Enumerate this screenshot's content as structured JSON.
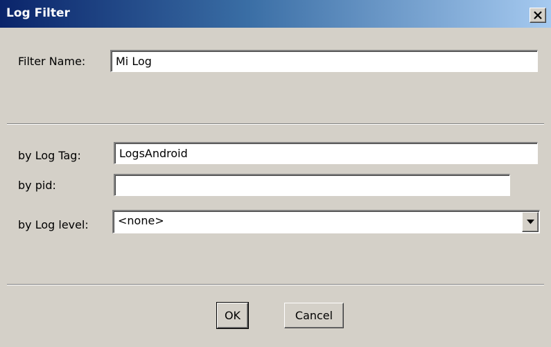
{
  "window": {
    "title": "Log Filter",
    "close_glyph": "X"
  },
  "filter_name": {
    "label": "Filter Name:",
    "value": "Mi Log"
  },
  "log_tag": {
    "label": "by Log Tag:",
    "value": "LogsAndroid"
  },
  "pid": {
    "label": "by pid:",
    "value": ""
  },
  "log_level": {
    "label": "by Log level:",
    "selected": "<none>"
  },
  "buttons": {
    "ok": "OK",
    "cancel": "Cancel"
  },
  "colors": {
    "dialog_bg": "#d4d0c8",
    "titlebar_start": "#0a246a",
    "titlebar_end": "#a6caf0"
  },
  "icons": {
    "close": "close-icon",
    "dropdown": "chevron-down-icon"
  }
}
